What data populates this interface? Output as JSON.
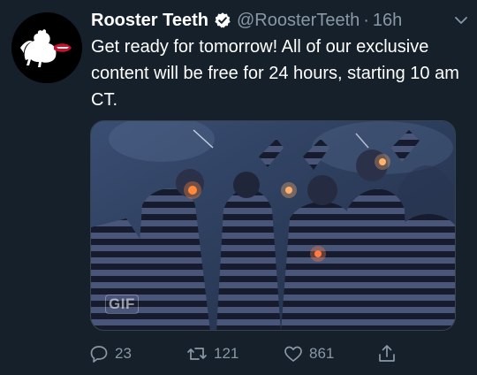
{
  "tweet": {
    "display_name": "Rooster Teeth",
    "handle": "@RoosterTeeth",
    "separator": "·",
    "time": "16h",
    "text": "Get ready for tomorrow! All of our exclusive content will be free for 24 hours, starting 10 am CT.",
    "media": {
      "badge": "GIF"
    },
    "actions": {
      "replies": "23",
      "retweets": "121",
      "likes": "861"
    }
  },
  "colors": {
    "background": "#15202b",
    "text": "#ffffff",
    "secondary": "#8899a6",
    "verified": "#ffffff",
    "brand_red": "#c8102e"
  },
  "icons": {
    "verified": "verified-badge-icon",
    "caret": "chevron-down-icon",
    "reply": "reply-icon",
    "retweet": "retweet-icon",
    "like": "heart-icon",
    "share": "share-icon"
  }
}
